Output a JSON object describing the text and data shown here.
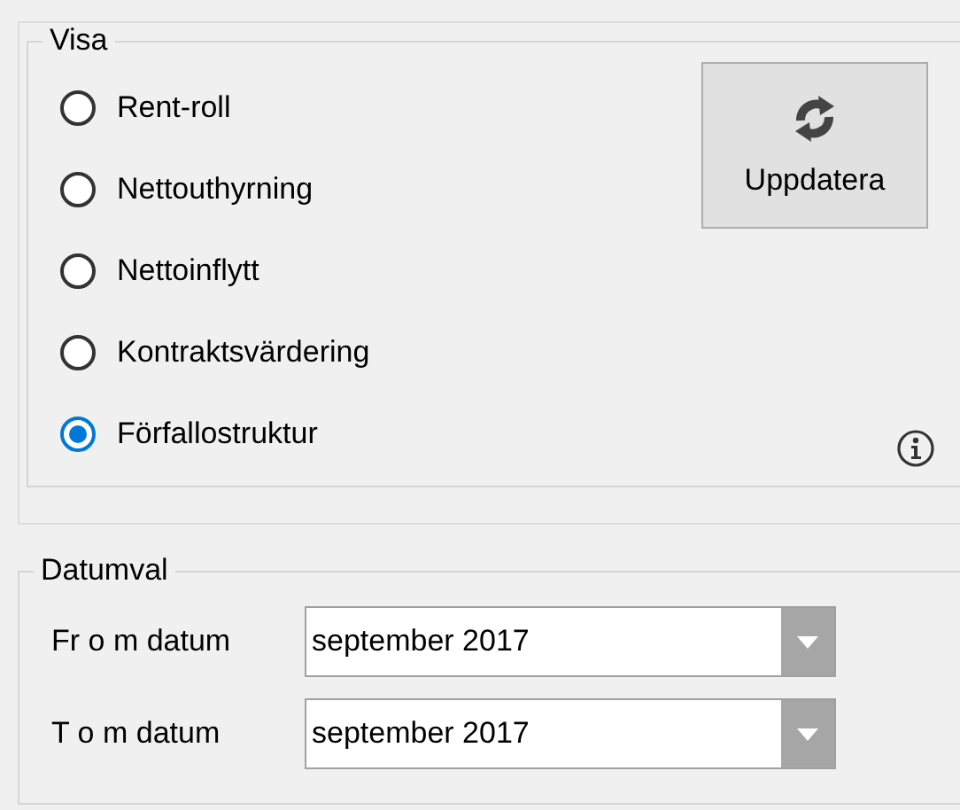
{
  "visa": {
    "title": "Visa",
    "options": [
      {
        "label": "Rent-roll",
        "selected": false
      },
      {
        "label": "Nettouthyrning",
        "selected": false
      },
      {
        "label": "Nettoinflytt",
        "selected": false
      },
      {
        "label": "Kontraktsvärdering",
        "selected": false
      },
      {
        "label": "Förfallostruktur",
        "selected": true
      }
    ],
    "button": "Uppdatera"
  },
  "datumval": {
    "title": "Datumval",
    "fields": [
      {
        "label": "Fr o m datum",
        "value": "september 2017"
      },
      {
        "label": "T o m datum",
        "value": "september 2017"
      }
    ]
  }
}
